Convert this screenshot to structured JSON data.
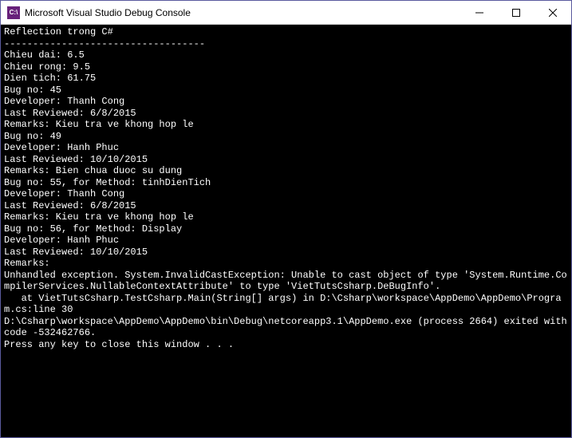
{
  "window": {
    "title": "Microsoft Visual Studio Debug Console",
    "icon_label": "C:\\"
  },
  "console": {
    "lines": [
      "Reflection trong C#",
      "-----------------------------------",
      "Chieu dai: 6.5",
      "Chieu rong: 9.5",
      "Dien tich: 61.75",
      "Bug no: 45",
      "Developer: Thanh Cong",
      "Last Reviewed: 6/8/2015",
      "Remarks: Kieu tra ve khong hop le",
      "Bug no: 49",
      "Developer: Hanh Phuc",
      "Last Reviewed: 10/10/2015",
      "Remarks: Bien chua duoc su dung",
      "Bug no: 55, for Method: tinhDienTich",
      "Developer: Thanh Cong",
      "Last Reviewed: 6/8/2015",
      "Remarks: Kieu tra ve khong hop le",
      "Bug no: 56, for Method: Display",
      "Developer: Hanh Phuc",
      "Last Reviewed: 10/10/2015",
      "Remarks:",
      "Unhandled exception. System.InvalidCastException: Unable to cast object of type 'System.Runtime.CompilerServices.NullableContextAttribute' to type 'VietTutsCsharp.DeBugInfo'.",
      "   at VietTutsCsharp.TestCsharp.Main(String[] args) in D:\\Csharp\\workspace\\AppDemo\\AppDemo\\Program.cs:line 30",
      "",
      "D:\\Csharp\\workspace\\AppDemo\\AppDemo\\bin\\Debug\\netcoreapp3.1\\AppDemo.exe (process 2664) exited with code -532462766.",
      "Press any key to close this window . . ."
    ]
  }
}
